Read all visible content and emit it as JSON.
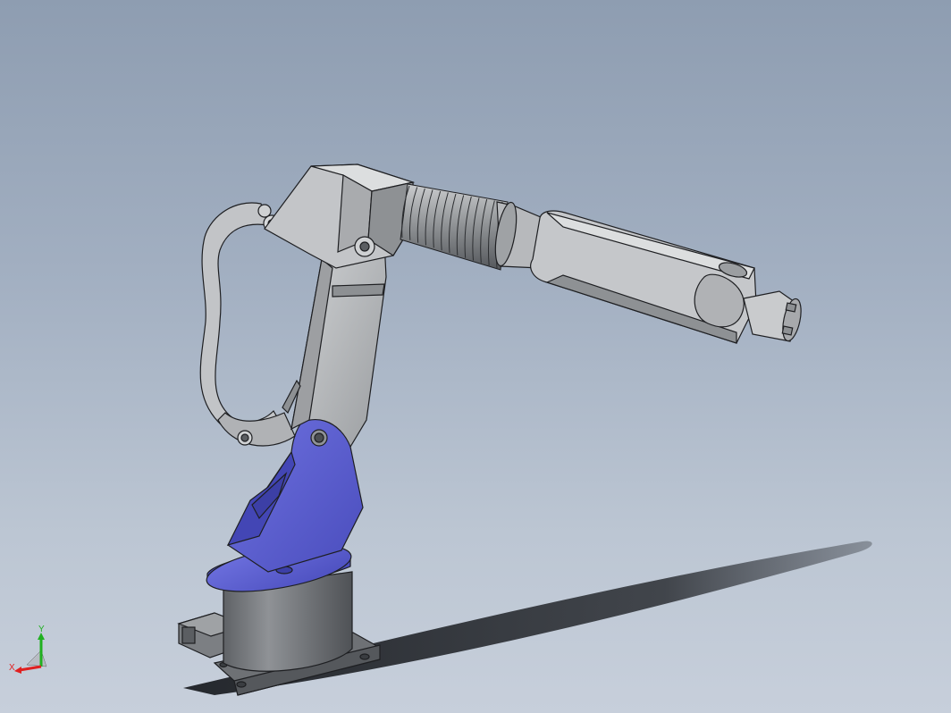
{
  "viewport": {
    "background_top": "#8e9db1",
    "background_bottom": "#c7cfdb"
  },
  "model": {
    "name": "robot-arm",
    "colors": {
      "body_gray": "#b4b6b9",
      "body_light": "#cfd1d3",
      "body_dark": "#7d8083",
      "base_blue": "#5c5fd0",
      "base_blue_dark": "#3c3fa6",
      "edge": "#1e1f22",
      "shadow": "#2b2e33"
    }
  },
  "triad": {
    "x_label": "X",
    "y_label": "Y",
    "x_color": "#e02020",
    "y_color": "#20b020",
    "z_color": "#2030d0"
  }
}
